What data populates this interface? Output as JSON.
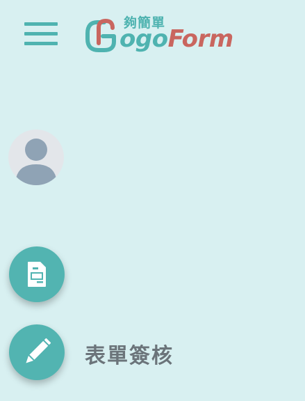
{
  "header": {
    "menu_icon": "hamburger-menu-icon",
    "logo": {
      "chinese_text": "夠簡單",
      "go_text": "ogo",
      "form_text": "Form",
      "brand_teal": "#4fb3b0",
      "brand_red": "#c9665f"
    }
  },
  "profile": {
    "avatar_icon": "user-avatar-icon"
  },
  "actions": [
    {
      "icon": "document-icon",
      "label": ""
    },
    {
      "icon": "pencil-icon",
      "label": "表單簽核"
    }
  ],
  "colors": {
    "background": "#d8f0f1",
    "accent": "#52b4b1",
    "label_text": "#6b747a"
  }
}
